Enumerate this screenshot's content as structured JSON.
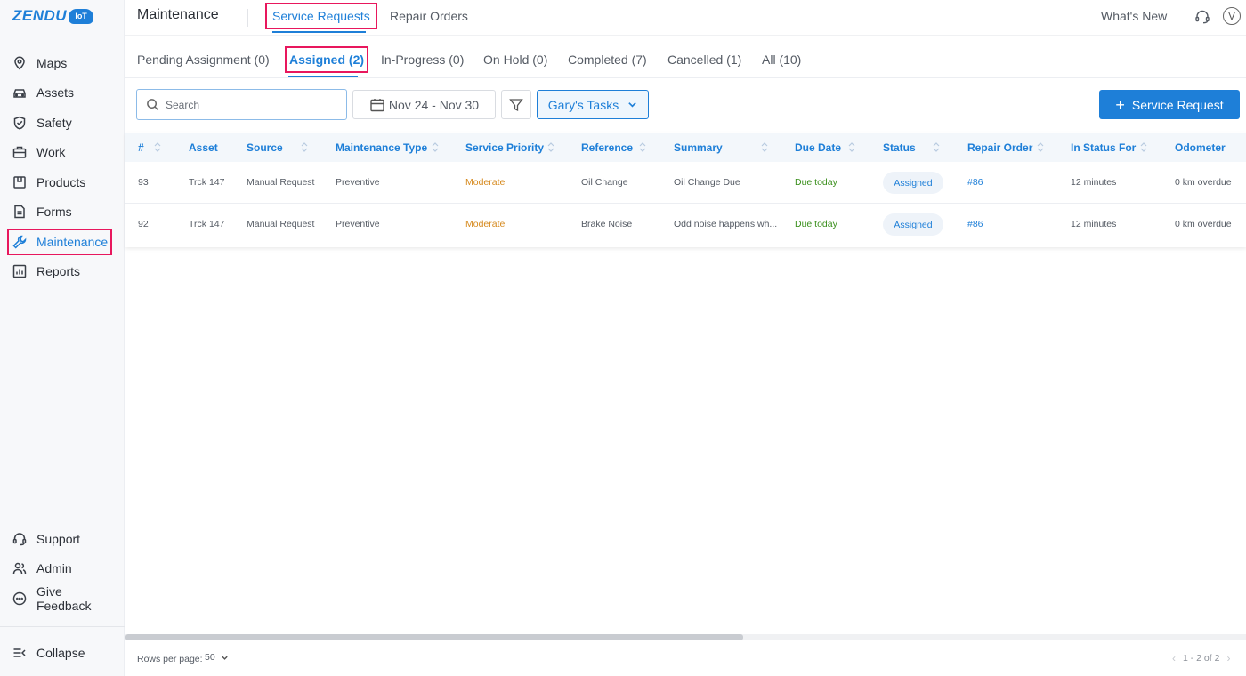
{
  "app": {
    "logo_text": "ZENDU",
    "logo_badge": "IoT"
  },
  "sidebar": {
    "items": [
      {
        "label": "Maps",
        "icon": "location-pin-icon"
      },
      {
        "label": "Assets",
        "icon": "car-icon"
      },
      {
        "label": "Safety",
        "icon": "shield-icon"
      },
      {
        "label": "Work",
        "icon": "briefcase-icon"
      },
      {
        "label": "Products",
        "icon": "box-icon"
      },
      {
        "label": "Forms",
        "icon": "document-icon"
      },
      {
        "label": "Maintenance",
        "icon": "wrench-icon",
        "active": true
      },
      {
        "label": "Reports",
        "icon": "bar-chart-icon"
      }
    ],
    "bottom_items": [
      {
        "label": "Support",
        "icon": "headset-icon"
      },
      {
        "label": "Admin",
        "icon": "users-icon"
      },
      {
        "label": "Give Feedback",
        "icon": "chat-bubble-icon"
      }
    ],
    "collapse_label": "Collapse"
  },
  "header": {
    "title": "Maintenance",
    "tabs": [
      {
        "label": "Service Requests",
        "active": true
      },
      {
        "label": "Repair Orders",
        "active": false
      }
    ],
    "whats_new": "What's New",
    "avatar_initial": "V"
  },
  "status_tabs": [
    {
      "label": "Pending Assignment (0)",
      "active": false
    },
    {
      "label": "Assigned (2)",
      "active": true
    },
    {
      "label": "In-Progress (0)",
      "active": false
    },
    {
      "label": "On Hold (0)",
      "active": false
    },
    {
      "label": "Completed (7)",
      "active": false
    },
    {
      "label": "Cancelled (1)",
      "active": false
    },
    {
      "label": "All (10)",
      "active": false
    }
  ],
  "toolbar": {
    "search_placeholder": "Search",
    "search_value": "",
    "date_range": "Nov 24 - Nov 30",
    "tasks_filter": "Gary's Tasks",
    "add_button": "Service Request"
  },
  "table": {
    "columns": [
      "#",
      "Asset",
      "Source",
      "Maintenance Type",
      "Service Priority",
      "Reference",
      "Summary",
      "Due Date",
      "Status",
      "Repair Order",
      "In Status For",
      "Odometer"
    ],
    "rows": [
      {
        "id": "93",
        "asset": "Trck 147",
        "source": "Manual Request",
        "type": "Preventive",
        "priority": "Moderate",
        "reference": "Oil Change",
        "summary": "Oil Change Due",
        "due": "Due today",
        "status": "Assigned",
        "repair_order": "#86",
        "in_status_for": "12 minutes",
        "odometer": "0 km overdue"
      },
      {
        "id": "92",
        "asset": "Trck 147",
        "source": "Manual Request",
        "type": "Preventive",
        "priority": "Moderate",
        "reference": "Brake Noise",
        "summary": "Odd noise happens wh...",
        "due": "Due today",
        "status": "Assigned",
        "repair_order": "#86",
        "in_status_for": "12 minutes",
        "odometer": "0 km overdue"
      }
    ]
  },
  "footer": {
    "rows_per_page_label": "Rows per page:",
    "rows_per_page_value": "50",
    "page_range": "1 - 2 of 2"
  },
  "colors": {
    "accent": "#1e7fd8",
    "highlight_box": "#e8175d",
    "priority_moderate": "#d68a1f",
    "due_today": "#3a8f1c"
  }
}
